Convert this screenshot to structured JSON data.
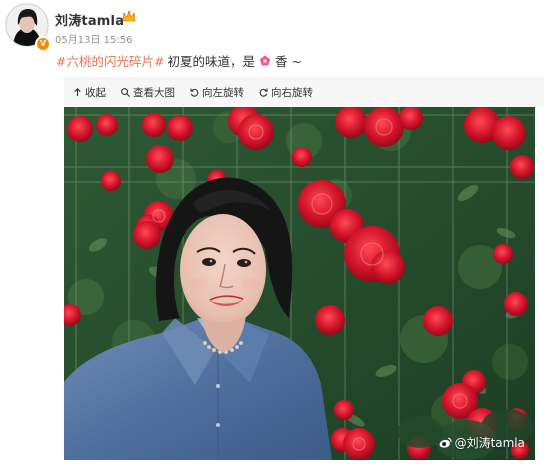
{
  "post": {
    "username": "刘涛tamla",
    "timestamp": "05月13日 15:56",
    "hashtag": "#六桃的闪光碎片#",
    "text_before": "初夏的味道，是",
    "text_after": "香 ~",
    "flower_icon": "flower-emoji-icon"
  },
  "toolbar": {
    "collapse_label": "收起",
    "view_large_label": "查看大图",
    "rotate_left_label": "向左旋转",
    "rotate_right_label": "向右旋转"
  },
  "photo": {
    "watermark": "@刘涛tamla"
  },
  "colors": {
    "hashtag": "#eb7350",
    "badge": "#ff8a00",
    "rose": "#d4152a",
    "leaves": "#2f5a35"
  }
}
